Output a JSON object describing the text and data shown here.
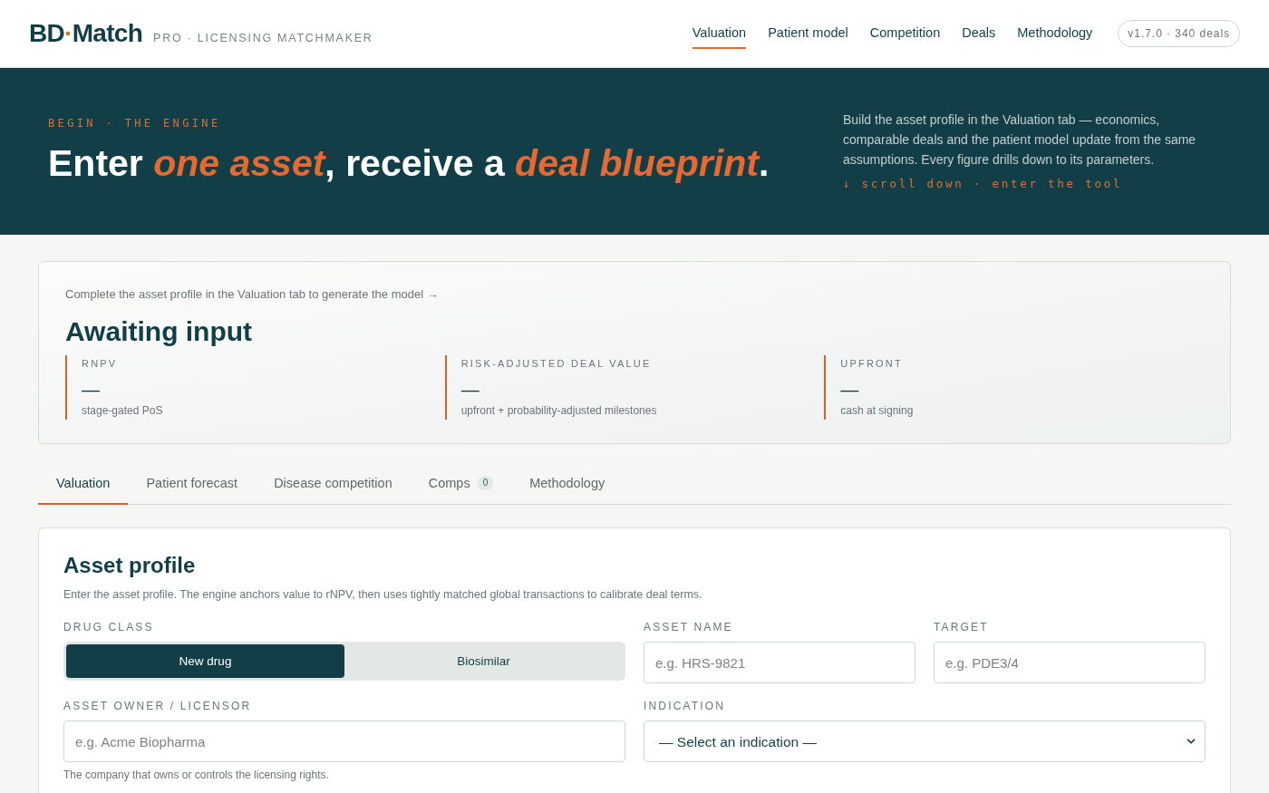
{
  "header": {
    "logo": [
      {
        "text": "BD",
        "accent": false
      },
      {
        "text": "·",
        "accent": true
      },
      {
        "text": "Match",
        "accent": false
      }
    ],
    "tagline": "PRO · LICENSING MATCHMAKER",
    "nav": [
      {
        "label": "Valuation",
        "selected": true
      },
      {
        "label": "Patient model",
        "selected": false
      },
      {
        "label": "Competition",
        "selected": false
      },
      {
        "label": "Deals",
        "selected": false
      },
      {
        "label": "Methodology",
        "selected": false
      }
    ],
    "version": "v1.7.0 · 340 deals"
  },
  "hero": {
    "eyebrow": "BEGIN · THE ENGINE",
    "headline": "Enter *one asset*, receive a *deal blueprint*.",
    "description": "Build the asset profile in the Valuation tab — economics, comparable deals and the patient model update from the same assumptions. Every figure drills down to its parameters.",
    "scroll_hint": "↓ scroll down · enter the tool"
  },
  "summary": {
    "hint": "Complete the asset profile in the Valuation tab to generate the model →",
    "title": "Awaiting input",
    "metrics": [
      {
        "label": "RNPV",
        "value": "—",
        "note": "stage-gated PoS"
      },
      {
        "label": "RISK-ADJUSTED DEAL VALUE",
        "value": "—",
        "note": "upfront + probability-adjusted milestones"
      },
      {
        "label": "UPFRONT",
        "value": "—",
        "note": "cash at signing"
      }
    ]
  },
  "tabs": [
    {
      "label": "Valuation",
      "selected": true
    },
    {
      "label": "Patient forecast",
      "selected": false
    },
    {
      "label": "Disease competition",
      "selected": false
    },
    {
      "label": "Comps",
      "badge": "0",
      "selected": false
    },
    {
      "label": "Methodology",
      "selected": false
    }
  ],
  "asset_profile": {
    "title": "Asset profile",
    "description": "Enter the asset profile. The engine anchors value to rNPV, then uses tightly matched global transactions to calibrate deal terms.",
    "rows": [
      [
        {
          "kind": "segmented",
          "label": "DRUG CLASS",
          "options": [
            {
              "label": "New drug",
              "selected": true
            },
            {
              "label": "Biosimilar",
              "selected": false
            }
          ]
        },
        {
          "kind": "text",
          "label": "ASSET NAME",
          "placeholder": "e.g. HRS-9821"
        },
        {
          "kind": "text",
          "label": "TARGET",
          "placeholder": "e.g. PDE3/4"
        }
      ],
      [
        {
          "kind": "text",
          "label": "ASSET OWNER / LICENSOR",
          "placeholder": "e.g. Acme Biopharma",
          "help": "The company that owns or controls the licensing rights."
        },
        {
          "kind": "select",
          "label": "INDICATION",
          "value": "— Select an indication —"
        }
      ]
    ]
  }
}
